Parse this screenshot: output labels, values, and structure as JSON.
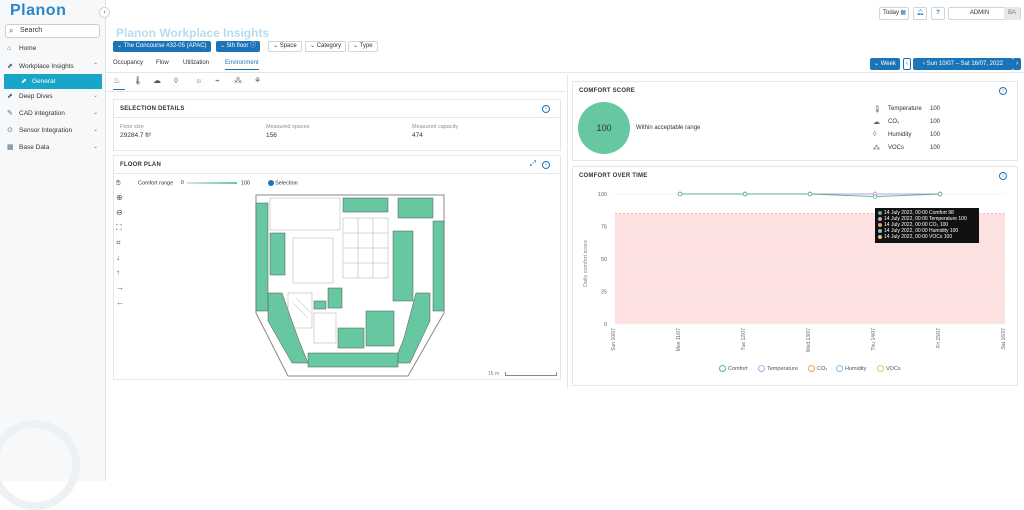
{
  "app": {
    "logo": "Planon",
    "title": "Planon Workplace Insights"
  },
  "sidebar": {
    "search_placeholder": "Search",
    "items": [
      {
        "label": "Home",
        "icon": "home-icon"
      },
      {
        "label": "Workplace Insights",
        "icon": "chart-icon",
        "expanded": true
      },
      {
        "label": "General",
        "icon": "chart-icon",
        "selected": true
      },
      {
        "label": "Deep Dives",
        "icon": "chart-icon"
      },
      {
        "label": "CAD integration",
        "icon": "pencil-icon"
      },
      {
        "label": "Sensor Integration",
        "icon": "sensor-icon"
      },
      {
        "label": "Base Data",
        "icon": "grid-icon"
      }
    ]
  },
  "topbar": {
    "today": "Today",
    "user": "ADMIN",
    "initials": "BA",
    "help": "?"
  },
  "filters": {
    "building": "The Concourse #32-05 (APAC)",
    "floor": "5th floor",
    "space": "Space",
    "category": "Category",
    "type": "Type"
  },
  "tabs": [
    "Occupancy",
    "Flow",
    "Utilization",
    "Environment"
  ],
  "active_tab": "Environment",
  "period": {
    "unit": "Week",
    "range": "Sun 10/07 – Sat 16/07, 2022"
  },
  "selection": {
    "title": "SELECTION DETAILS",
    "floor_size_label": "Floor size",
    "floor_size": "29284.7 ft²",
    "spaces_label": "Measured spaces",
    "spaces": "156",
    "capacity_label": "Measured capacity",
    "capacity": "474"
  },
  "floorplan": {
    "title": "FLOOR PLAN",
    "range_label": "Comfort range",
    "range_min": "0",
    "range_max": "100",
    "selection_label": "Selection",
    "scale": "15 m"
  },
  "comfort_score": {
    "title": "COMFORT SCORE",
    "score": "100",
    "status": "Within acceptable range",
    "metrics": [
      {
        "name": "Temperature",
        "value": "100",
        "icon": "thermometer-icon"
      },
      {
        "name": "CO₂",
        "value": "100",
        "icon": "cloud-icon"
      },
      {
        "name": "Humidity",
        "value": "100",
        "icon": "drop-icon"
      },
      {
        "name": "VOCs",
        "value": "100",
        "icon": "molecule-icon"
      }
    ]
  },
  "chart_data": {
    "type": "line",
    "title": "COMFORT OVER TIME",
    "ylabel": "Daily comfort score",
    "ylim": [
      0,
      100
    ],
    "yticks": [
      "100",
      "75",
      "50",
      "25",
      "0"
    ],
    "categories": [
      "Sun 10/07",
      "Mon 11/07",
      "Tue 12/07",
      "Wed 13/07",
      "Thu 14/07",
      "Fri 15/07",
      "Sat 16/07"
    ],
    "series": [
      {
        "name": "Comfort",
        "color": "#58b38a",
        "values": [
          100,
          100,
          100,
          98,
          100
        ]
      },
      {
        "name": "Temperature",
        "color": "#c59be6",
        "values": [
          100,
          100,
          100,
          100,
          100
        ]
      },
      {
        "name": "CO₂",
        "color": "#e9a15c",
        "values": [
          100,
          100,
          100,
          100,
          100
        ]
      },
      {
        "name": "Humidity",
        "color": "#7fc0e0",
        "values": [
          100,
          100,
          100,
          100,
          100
        ]
      },
      {
        "name": "VOCs",
        "color": "#f0c061",
        "values": [
          100,
          100,
          100,
          100,
          100
        ]
      }
    ],
    "threshold_band": {
      "from": 0,
      "to": 85,
      "color": "#fde0e0"
    },
    "tooltip": [
      "14 July 2022, 00:00 Comfort 98",
      "14 July 2022, 00:00 Temperature 100",
      "14 July 2022, 00:00 CO₂ 100",
      "14 July 2022, 00:00 Humidity 100",
      "14 July 2022, 00:00 VOCs 100"
    ]
  }
}
